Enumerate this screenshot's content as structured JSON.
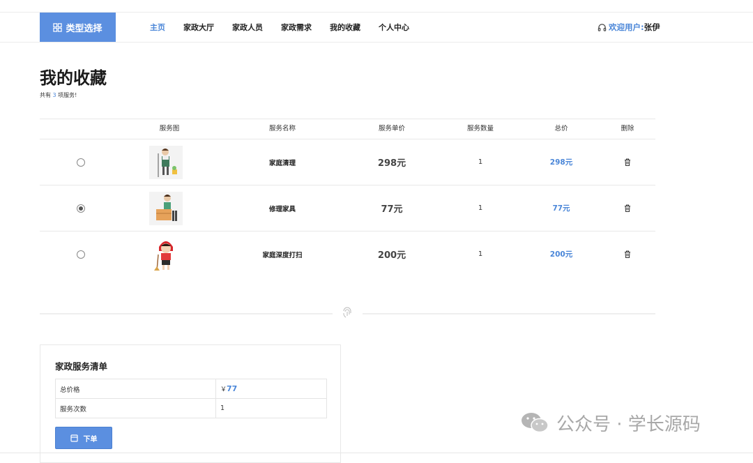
{
  "header": {
    "brand_label": "类型选择",
    "brand_icon": "grid-icon",
    "nav": [
      "主页",
      "家政大厅",
      "家政人员",
      "家政需求",
      "我的收藏",
      "个人中心"
    ],
    "active_index": 0,
    "welcome_label": "欢迎用户:",
    "username": "张伊",
    "accent": "#4a86d8"
  },
  "page": {
    "title": "我的收藏",
    "subtitle_prefix": "共有 ",
    "count": "3",
    "subtitle_suffix": " 项服务!"
  },
  "table": {
    "headers": [
      "服务图",
      "服务名称",
      "服务单价",
      "服务数量",
      "总价",
      "删除"
    ],
    "rows": [
      {
        "selected": false,
        "name": "家庭清理",
        "price": "298元",
        "qty": "1",
        "total": "298元"
      },
      {
        "selected": true,
        "name": "修理家具",
        "price": "77元",
        "qty": "1",
        "total": "77元"
      },
      {
        "selected": false,
        "name": "家庭深度打扫",
        "price": "200元",
        "qty": "1",
        "total": "200元"
      }
    ]
  },
  "summary": {
    "title": "家政服务清单",
    "total_label": "总价格",
    "currency": "￥",
    "total_value": "77",
    "count_label": "服务次数",
    "count_value": "1",
    "order_button": "下单"
  },
  "watermark": {
    "text": "公众号 · 学长源码"
  }
}
